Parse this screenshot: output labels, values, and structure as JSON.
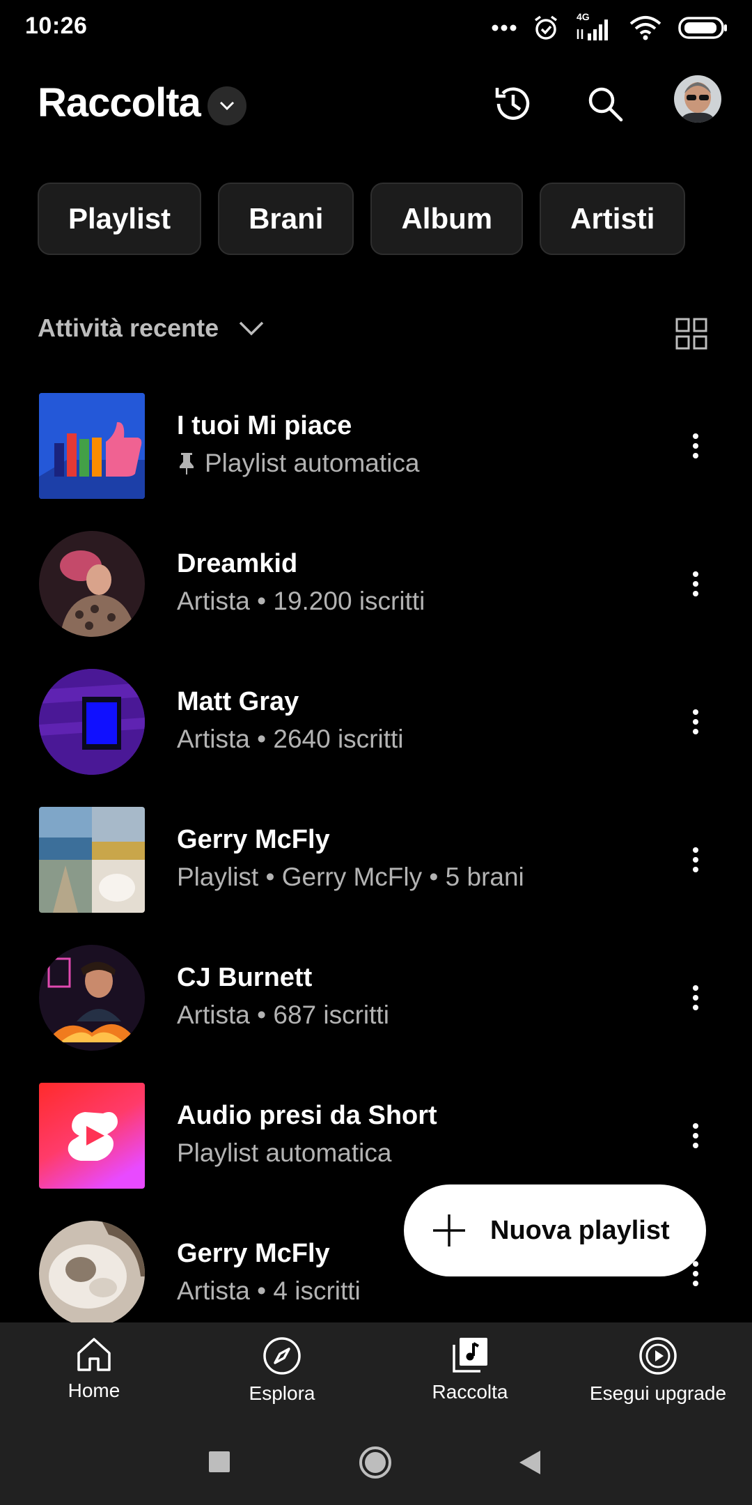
{
  "status_bar": {
    "time": "10:26",
    "network": "4G"
  },
  "header": {
    "title": "Raccolta",
    "icons": [
      "chevron-down-icon",
      "history-icon",
      "search-icon",
      "avatar"
    ]
  },
  "chips": [
    "Playlist",
    "Brani",
    "Album",
    "Artisti"
  ],
  "sort": {
    "label": "Attività recente"
  },
  "items": [
    {
      "title": "I tuoi Mi piace",
      "subtitle": "Playlist automatica",
      "pinned": true
    },
    {
      "title": "Dreamkid",
      "subtitle": "Artista • 19.200 iscritti"
    },
    {
      "title": "Matt Gray",
      "subtitle": "Artista • 2640 iscritti"
    },
    {
      "title": "Gerry McFly",
      "subtitle": "Playlist • Gerry McFly • 5 brani"
    },
    {
      "title": "CJ Burnett",
      "subtitle": "Artista • 687 iscritti"
    },
    {
      "title": "Audio presi da Short",
      "subtitle": "Playlist automatica"
    },
    {
      "title": "Gerry McFly",
      "subtitle": "Artista • 4 iscritti"
    }
  ],
  "fab": {
    "label": "Nuova playlist"
  },
  "bottom_nav": [
    {
      "label": "Home",
      "icon": "home-icon"
    },
    {
      "label": "Esplora",
      "icon": "compass-icon"
    },
    {
      "label": "Raccolta",
      "icon": "library-icon",
      "active": true
    },
    {
      "label": "Esegui upgrade",
      "icon": "play-circle-icon"
    }
  ],
  "colors": {
    "background": "#000000",
    "chip_bg": "#1c1c1c",
    "nav_bg": "#212121",
    "subtitle": "#b3b3b3",
    "fab_bg": "#ffffff"
  }
}
